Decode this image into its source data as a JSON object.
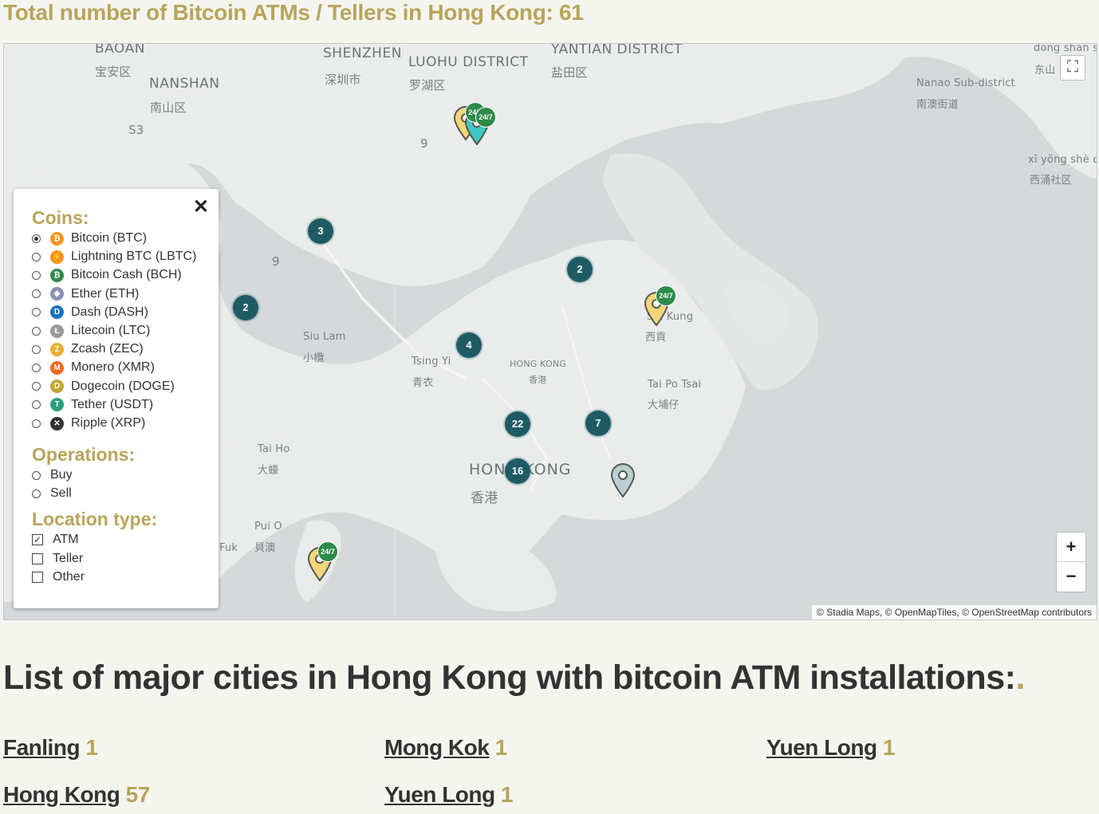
{
  "headline": "Total number of Bitcoin ATMs / Tellers in Hong Kong: 61",
  "map": {
    "labels": {
      "baoan": "BAOAN",
      "baoan_zh": "宝安区",
      "shenzhen": "SHENZHEN",
      "shenzhen_zh": "深圳市",
      "luohu": "LUOHU DISTRICT",
      "luohu_zh": "罗湖区",
      "yantian": "YANTIAN DISTRICT",
      "yantian_zh": "盐田区",
      "nanshan": "NANSHAN",
      "nanshan_zh": "南山区",
      "s3": "S3",
      "dongshan": "dōng shān s",
      "dongshan_zh": "东山",
      "nanao": "Nanao Sub-district",
      "nanao_zh": "南澳街道",
      "xiyong": "xī yǒng shè q",
      "xiyong_zh": "西涌社区",
      "route9a": "9",
      "route9b": "9",
      "siulam": "Siu Lam",
      "siulam_zh": "小欖",
      "tsingyi": "Tsing Yi",
      "tsingyi_zh": "青衣",
      "hongkong_sm": "HONG KONG",
      "hongkong_sm_zh": "香港",
      "saikung": "Sai Kung",
      "saikung_zh": "西貢",
      "taipotsai": "Tai Po Tsai",
      "taipotsai_zh": "大埔仔",
      "taiho": "Tai Ho",
      "taiho_zh": "大蠔",
      "hongkong_big": "HONG KONG",
      "hongkong_big_zh": "香港",
      "puio": "Pui O",
      "puio_zh": "貝澳",
      "fuk": "Fuk"
    },
    "clusters": [
      "3",
      "2",
      "2",
      "4",
      "22",
      "7",
      "16"
    ],
    "badge": "24/7",
    "attribution": "© Stadia Maps, © OpenMapTiles, © OpenStreetMap contributors",
    "zoom_in": "+",
    "zoom_out": "−"
  },
  "filters": {
    "coins_title": "Coins:",
    "coins": [
      {
        "label": "Bitcoin (BTC)",
        "color": "#f7931a",
        "glyph": "₿",
        "selected": true
      },
      {
        "label": "Lightning BTC (LBTC)",
        "color": "#f7931a",
        "glyph": "⚡",
        "selected": false
      },
      {
        "label": "Bitcoin Cash (BCH)",
        "color": "#2e8a4a",
        "glyph": "₿",
        "selected": false
      },
      {
        "label": "Ether (ETH)",
        "color": "#8a92b2",
        "glyph": "◆",
        "selected": false
      },
      {
        "label": "Dash (DASH)",
        "color": "#1c75bc",
        "glyph": "D",
        "selected": false
      },
      {
        "label": "Litecoin (LTC)",
        "color": "#9a9a9a",
        "glyph": "Ł",
        "selected": false
      },
      {
        "label": "Zcash (ZEC)",
        "color": "#e8b030",
        "glyph": "Z",
        "selected": false
      },
      {
        "label": "Monero (XMR)",
        "color": "#f26822",
        "glyph": "M",
        "selected": false
      },
      {
        "label": "Dogecoin (DOGE)",
        "color": "#c2a633",
        "glyph": "D",
        "selected": false
      },
      {
        "label": "Tether (USDT)",
        "color": "#26a17b",
        "glyph": "T",
        "selected": false
      },
      {
        "label": "Ripple (XRP)",
        "color": "#333333",
        "glyph": "✕",
        "selected": false
      }
    ],
    "operations_title": "Operations:",
    "operations": [
      "Buy",
      "Sell"
    ],
    "location_title": "Location type:",
    "locations": [
      {
        "label": "ATM",
        "checked": true
      },
      {
        "label": "Teller",
        "checked": false
      },
      {
        "label": "Other",
        "checked": false
      }
    ]
  },
  "cities_title": "List of major cities in Hong Kong with bitcoin ATM installations:",
  "cities": [
    {
      "name": "Fanling",
      "count": "1"
    },
    {
      "name": "Mong Kok",
      "count": "1"
    },
    {
      "name": "Yuen Long",
      "count": "1"
    },
    {
      "name": "Hong Kong",
      "count": "57"
    },
    {
      "name": "Yuen Long",
      "count": "1"
    }
  ]
}
